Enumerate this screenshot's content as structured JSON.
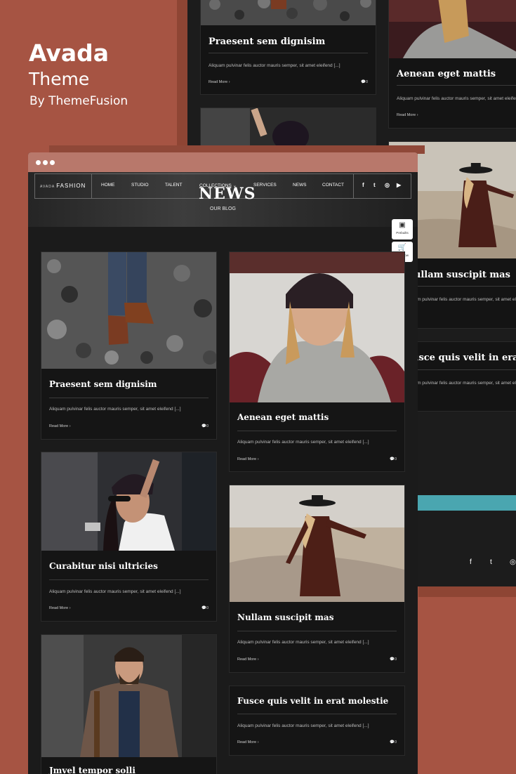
{
  "promo": {
    "title": "Avada",
    "subtitle": "Theme",
    "byline": "By ThemeFusion"
  },
  "site": {
    "logo_small": "AVADA",
    "logo_main": "FASHION",
    "nav": [
      {
        "label": "HOME"
      },
      {
        "label": "STUDIO"
      },
      {
        "label": "TALENT"
      },
      {
        "label": "COLLECTIONS ⌄"
      },
      {
        "label": "SERVICES"
      },
      {
        "label": "NEWS"
      },
      {
        "label": "CONTACT"
      }
    ],
    "social": [
      "f",
      "t",
      "◎",
      "▶"
    ],
    "page_title": "NEWS",
    "page_subtitle": "OUR BLOG",
    "side_buttons": [
      {
        "icon": "▣",
        "label": "Prebuilts"
      },
      {
        "icon": "🛒",
        "label": "Buy Now"
      }
    ]
  },
  "post_common": {
    "excerpt": "Aliquam pulvinar felis auctor mauris semper, sit amet eleifend [...]",
    "read_more": "Read More ›",
    "comments": "0"
  },
  "posts": [
    {
      "title": "Praesent sem dignisim"
    },
    {
      "title": "Aenean eget mattis"
    },
    {
      "title": "Curabitur nisi ultricies"
    },
    {
      "title": "Nullam suscipit mas"
    },
    {
      "title": "Jmvel tempor solli"
    },
    {
      "title": "Fusce quis velit in erat molestie"
    }
  ],
  "bg_window": {
    "titles": [
      "Praesent sem dignisim",
      "Aenean eget mattis",
      "Nullam suscipit mas",
      "Fusce quis velit in erat molestie"
    ],
    "social": [
      "f",
      "t",
      "◎"
    ]
  },
  "colors": {
    "background": "#a65443",
    "chrome": "#b8786b",
    "dark": "#1b1b1b",
    "teal": "#4aa6b0"
  }
}
